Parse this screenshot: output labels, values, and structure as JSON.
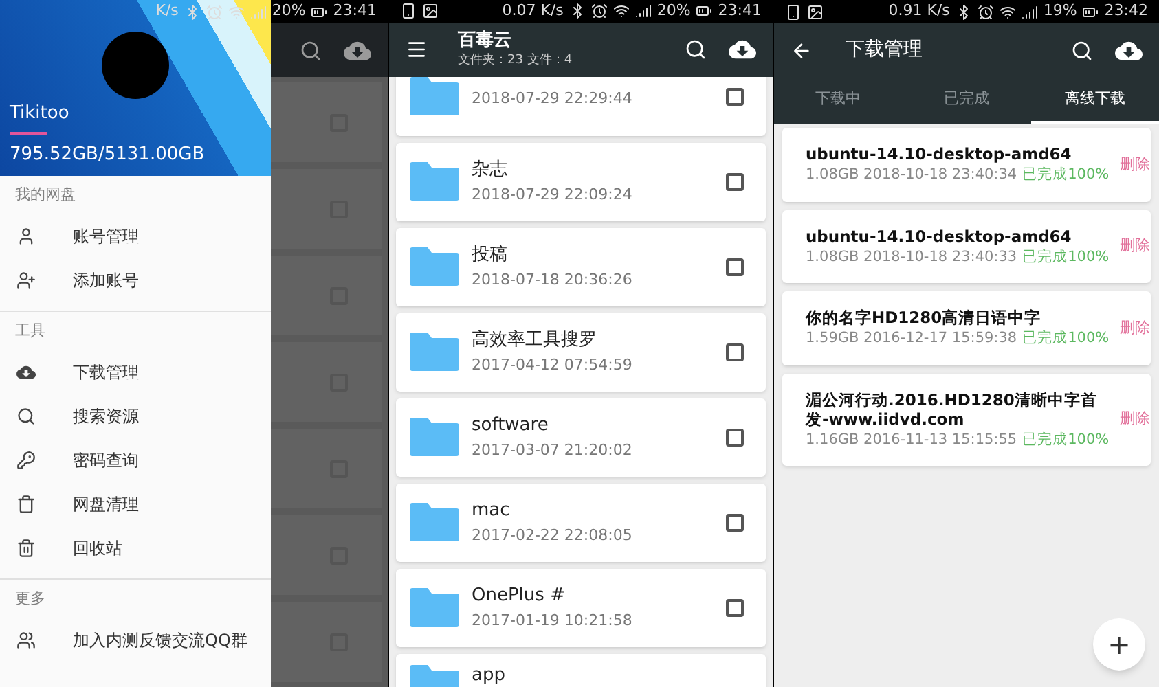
{
  "drawer_screen": {
    "status_bar": {
      "speed": "K/s",
      "battery": "20%",
      "time": "23:41"
    },
    "header": {
      "user_name": "Tikitoo",
      "quota": "795.52GB/5131.00GB"
    },
    "sections": [
      {
        "title": "我的网盘",
        "items": [
          {
            "kind": "account",
            "label": "账号管理"
          },
          {
            "kind": "add_account",
            "label": "添加账号"
          }
        ]
      },
      {
        "title": "工具",
        "items": [
          {
            "kind": "download",
            "label": "下载管理"
          },
          {
            "kind": "search",
            "label": "搜索资源"
          },
          {
            "kind": "password",
            "label": "密码查询"
          },
          {
            "kind": "clean",
            "label": "网盘清理"
          },
          {
            "kind": "trash",
            "label": "回收站"
          }
        ]
      },
      {
        "title": "更多",
        "items": [
          {
            "kind": "group",
            "label": "加入内测反馈交流QQ群"
          }
        ]
      }
    ],
    "background_checkboxes": [
      {
        "checked": false
      },
      {
        "checked": false
      },
      {
        "checked": false
      },
      {
        "checked": false
      },
      {
        "checked": false
      },
      {
        "checked": false
      },
      {
        "checked": false
      }
    ]
  },
  "files_screen": {
    "status_bar": {
      "speed": "0.07 K/s",
      "battery": "20%",
      "time": "23:41"
    },
    "toolbar": {
      "title": "百毒云",
      "subtitle": "文件夹：23 文件：4"
    },
    "folders": [
      {
        "date": "2018-07-29 22:29:44",
        "checked": false
      },
      {
        "name": "杂志",
        "date": "2018-07-29 22:09:24",
        "checked": false
      },
      {
        "name": "投稿",
        "date": "2018-07-18 20:36:26",
        "checked": false
      },
      {
        "name": "高效率工具搜罗",
        "date": "2017-04-12 07:54:59",
        "checked": false
      },
      {
        "name": "software",
        "date": "2017-03-07 21:20:02",
        "checked": false
      },
      {
        "name": "mac",
        "date": "2017-02-22 22:08:05",
        "checked": false
      },
      {
        "name": "OnePlus #",
        "date": "2017-01-19 10:21:58",
        "checked": false
      },
      {
        "name": "app"
      }
    ]
  },
  "downloads_screen": {
    "status_bar": {
      "speed": "0.91 K/s",
      "battery": "19%",
      "time": "23:42"
    },
    "toolbar": {
      "title": "下载管理"
    },
    "tabs": [
      {
        "label": "下载中",
        "selected": false
      },
      {
        "label": "已完成",
        "selected": false
      },
      {
        "label": "离线下载",
        "selected": true
      }
    ],
    "tasks": [
      {
        "name": "ubuntu-14.10-desktop-amd64",
        "size_date": "1.08GB 2018-10-18 23:40:34",
        "status": "已完成100%",
        "action": "删除"
      },
      {
        "name": "ubuntu-14.10-desktop-amd64",
        "size_date": "1.08GB 2018-10-18 23:40:33",
        "status": "已完成100%",
        "action": "删除"
      },
      {
        "name": "你的名字HD1280高清日语中字",
        "size_date": "1.59GB 2016-12-17 15:59:38",
        "status": "已完成100%",
        "action": "删除"
      },
      {
        "name": "湄公河行动.2016.HD1280清晰中字首发-www.iidvd.com",
        "size_date": "1.16GB 2016-11-13 15:15:55",
        "status": "已完成100%",
        "action": "删除"
      }
    ],
    "fab": {
      "label": "+"
    }
  }
}
